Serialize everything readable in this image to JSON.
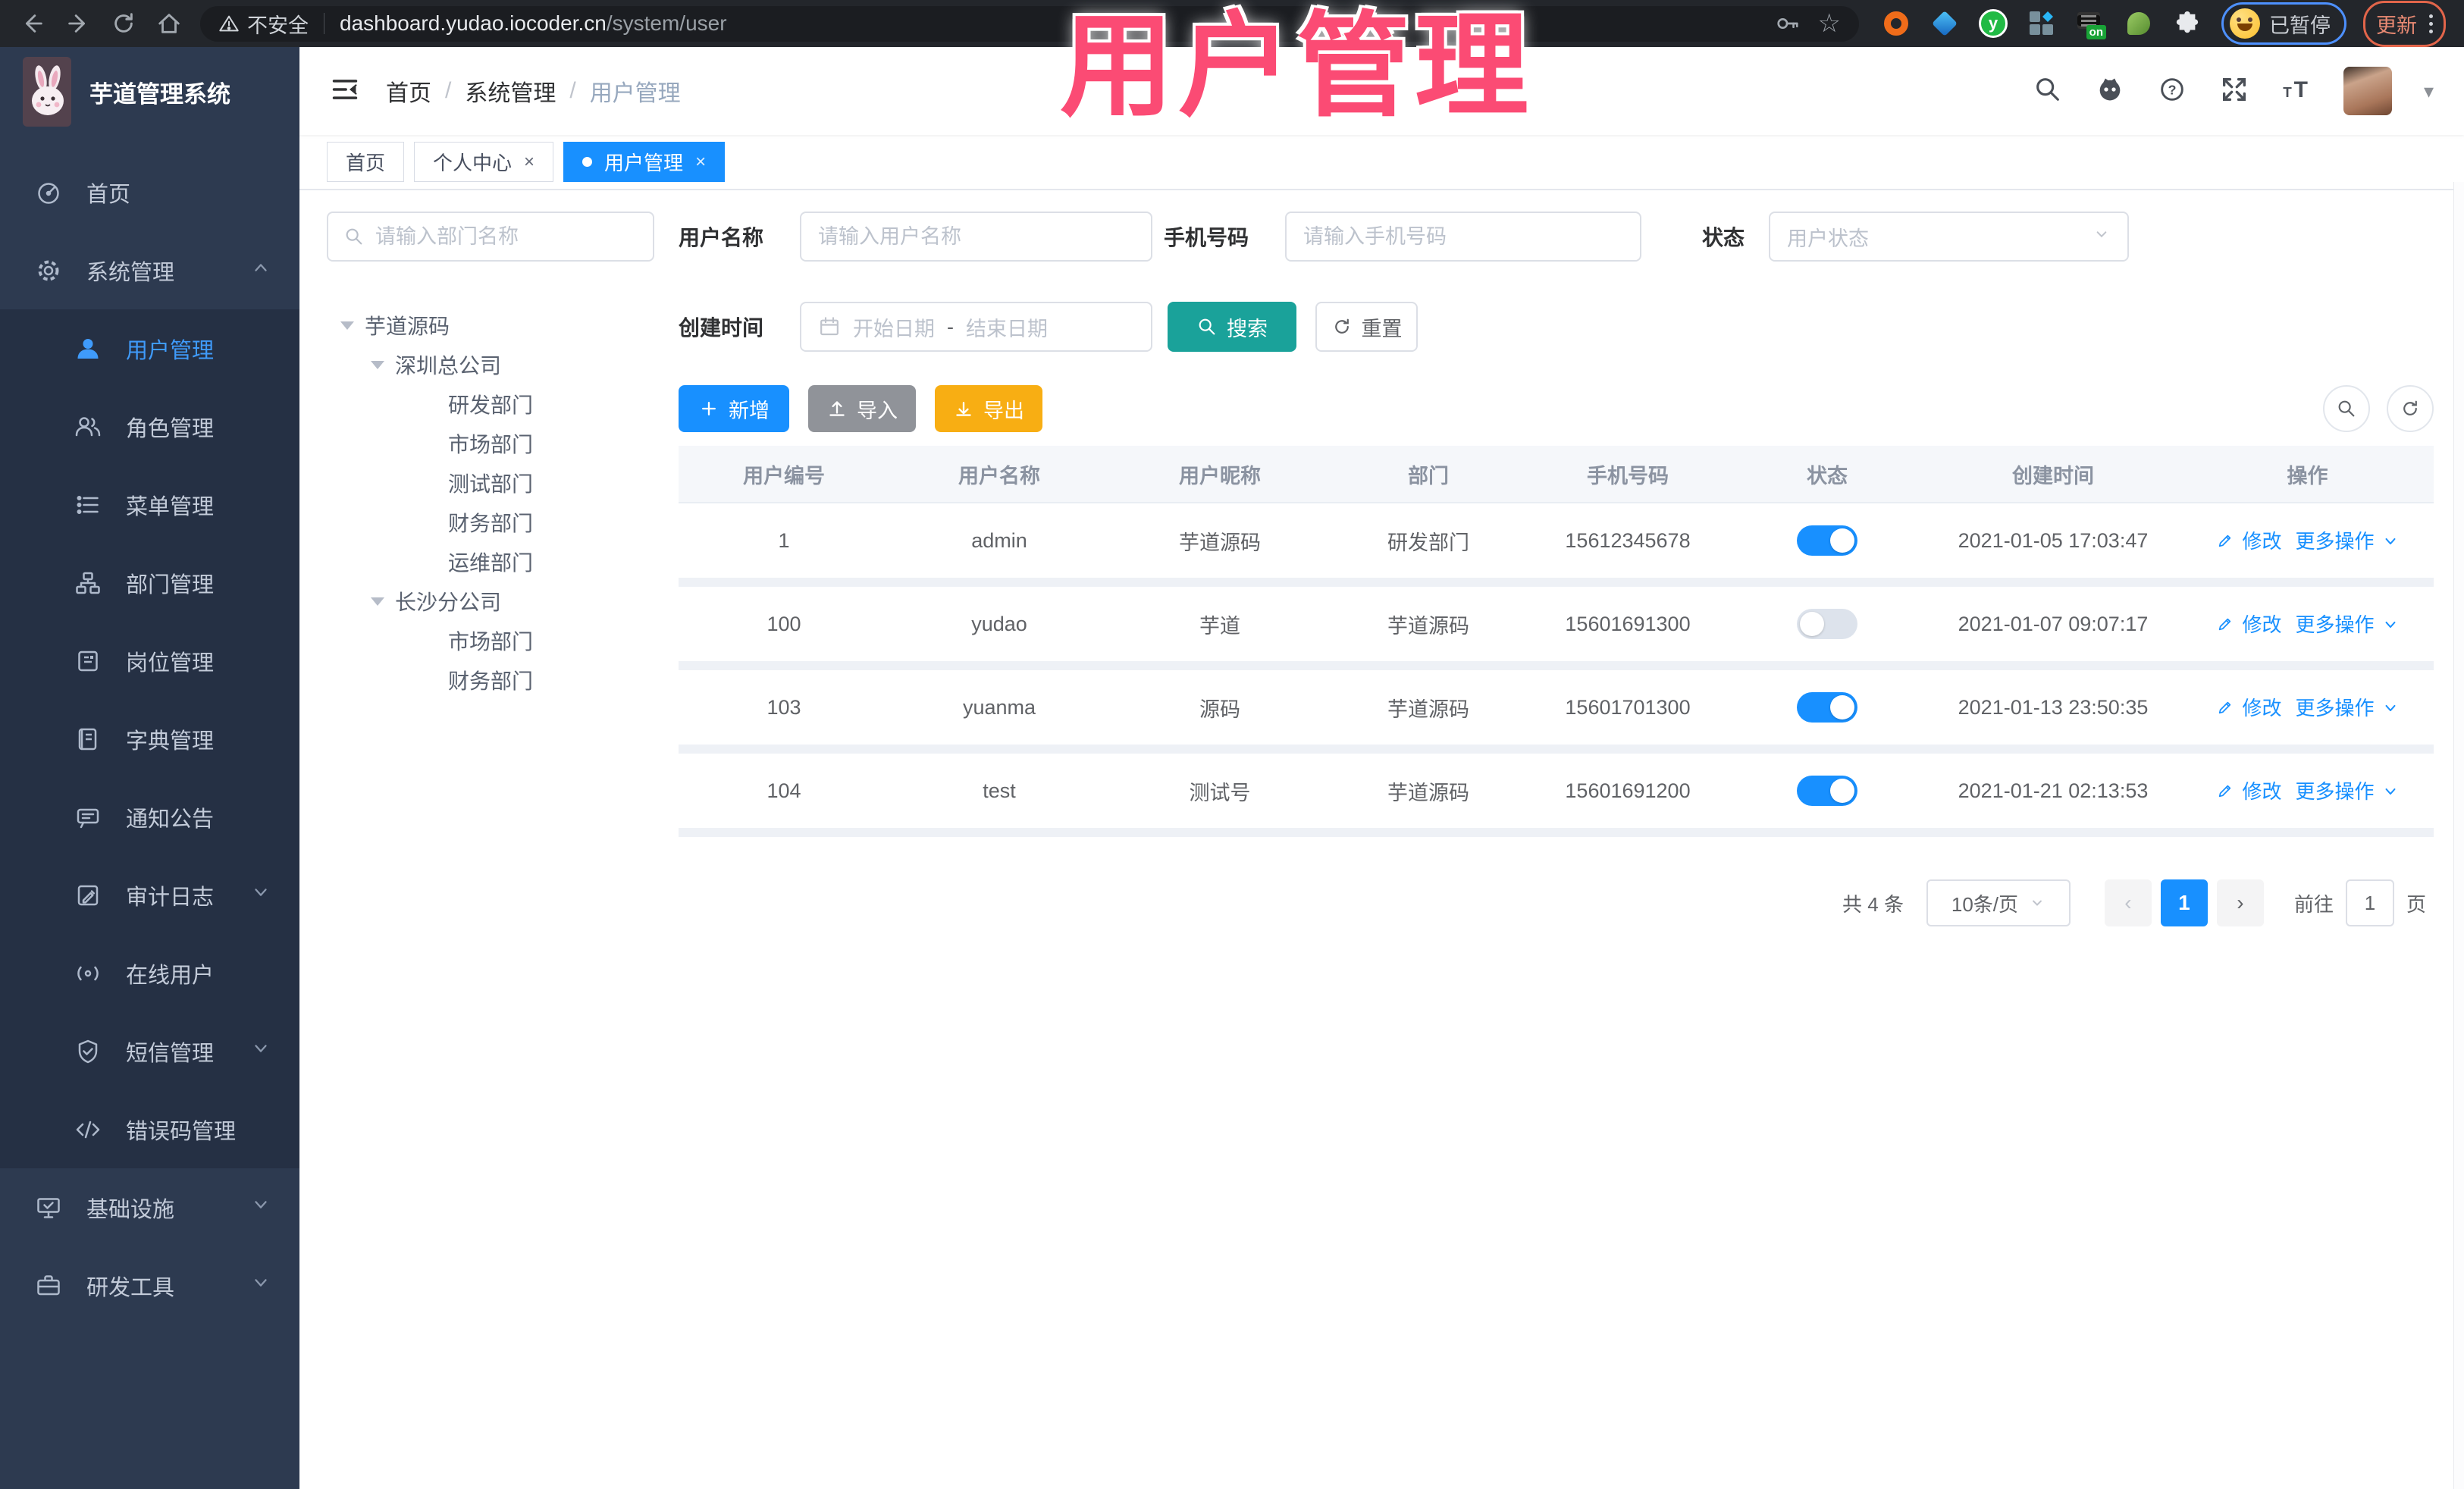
{
  "colors": {
    "accent": "#1890ff",
    "search_teal": "#1aa29a",
    "export_amber": "#f8ae13",
    "overlay_pink": "#fb4b74"
  },
  "overlay_title": "用户管理",
  "browser": {
    "security_label": "不安全",
    "url_host": "dashboard.yudao.iocoder.cn",
    "url_path": "/system/user",
    "paused_badge": "已暂停",
    "update_label": "更新"
  },
  "sidebar": {
    "app_title": "芋道管理系统",
    "items": [
      {
        "label": "首页",
        "icon": "dashboard-icon",
        "level": 0
      },
      {
        "label": "系统管理",
        "icon": "gear-icon",
        "level": 0,
        "chevron": "up"
      },
      {
        "label": "用户管理",
        "icon": "user-icon",
        "level": 1,
        "active": true
      },
      {
        "label": "角色管理",
        "icon": "users-icon",
        "level": 1
      },
      {
        "label": "菜单管理",
        "icon": "menu-list-icon",
        "level": 1
      },
      {
        "label": "部门管理",
        "icon": "org-tree-icon",
        "level": 1
      },
      {
        "label": "岗位管理",
        "icon": "badge-icon",
        "level": 1
      },
      {
        "label": "字典管理",
        "icon": "dictionary-icon",
        "level": 1
      },
      {
        "label": "通知公告",
        "icon": "announcement-icon",
        "level": 1
      },
      {
        "label": "审计日志",
        "icon": "audit-log-icon",
        "level": 1,
        "chevron": "down"
      },
      {
        "label": "在线用户",
        "icon": "online-user-icon",
        "level": 1
      },
      {
        "label": "短信管理",
        "icon": "sms-shield-icon",
        "level": 1,
        "chevron": "down"
      },
      {
        "label": "错误码管理",
        "icon": "error-code-icon",
        "level": 1
      },
      {
        "label": "基础设施",
        "icon": "infrastructure-icon",
        "level": 0,
        "chevron": "down"
      },
      {
        "label": "研发工具",
        "icon": "dev-tools-icon",
        "level": 0,
        "chevron": "down"
      }
    ]
  },
  "app_header": {
    "breadcrumb": [
      {
        "label": "首页",
        "muted": false
      },
      {
        "label": "系统管理",
        "muted": false
      },
      {
        "label": "用户管理",
        "muted": true
      }
    ]
  },
  "tabs": [
    {
      "label": "首页",
      "closable": false,
      "active": false
    },
    {
      "label": "个人中心",
      "closable": true,
      "active": false
    },
    {
      "label": "用户管理",
      "closable": true,
      "active": true
    }
  ],
  "dept_panel": {
    "search_placeholder": "请输入部门名称",
    "tree": [
      {
        "label": "芋道源码",
        "level": 0,
        "expandable": true
      },
      {
        "label": "深圳总公司",
        "level": 1,
        "expandable": true
      },
      {
        "label": "研发部门",
        "level": 2
      },
      {
        "label": "市场部门",
        "level": 2
      },
      {
        "label": "测试部门",
        "level": 2
      },
      {
        "label": "财务部门",
        "level": 2
      },
      {
        "label": "运维部门",
        "level": 2
      },
      {
        "label": "长沙分公司",
        "level": 1,
        "expandable": true
      },
      {
        "label": "市场部门",
        "level": 2
      },
      {
        "label": "财务部门",
        "level": 2
      }
    ]
  },
  "filters": {
    "username_label": "用户名称",
    "username_placeholder": "请输入用户名称",
    "mobile_label": "手机号码",
    "mobile_placeholder": "请输入手机号码",
    "status_label": "状态",
    "status_placeholder": "用户状态",
    "create_time_label": "创建时间",
    "date_start_placeholder": "开始日期",
    "date_range_separator": "-",
    "date_end_placeholder": "结束日期",
    "search_label": "搜索",
    "reset_label": "重置"
  },
  "toolbar": {
    "add_label": "新增",
    "import_label": "导入",
    "export_label": "导出"
  },
  "table": {
    "headers": [
      "用户编号",
      "用户名称",
      "用户昵称",
      "部门",
      "手机号码",
      "状态",
      "创建时间",
      "操作"
    ],
    "rows": [
      {
        "id": "1",
        "username": "admin",
        "nickname": "芋道源码",
        "dept": "研发部门",
        "mobile": "15612345678",
        "status_on": true,
        "created": "2021-01-05 17:03:47"
      },
      {
        "id": "100",
        "username": "yudao",
        "nickname": "芋道",
        "dept": "芋道源码",
        "mobile": "15601691300",
        "status_on": false,
        "created": "2021-01-07 09:07:17"
      },
      {
        "id": "103",
        "username": "yuanma",
        "nickname": "源码",
        "dept": "芋道源码",
        "mobile": "15601701300",
        "status_on": true,
        "created": "2021-01-13 23:50:35"
      },
      {
        "id": "104",
        "username": "test",
        "nickname": "测试号",
        "dept": "芋道源码",
        "mobile": "15601691200",
        "status_on": true,
        "created": "2021-01-21 02:13:53"
      }
    ],
    "edit_label": "修改",
    "more_label": "更多操作"
  },
  "pagination": {
    "total_label": "共 4 条",
    "page_size_label": "10条/页",
    "current_page": "1",
    "goto_label": "前往",
    "goto_value": "1",
    "page_unit_label": "页"
  }
}
